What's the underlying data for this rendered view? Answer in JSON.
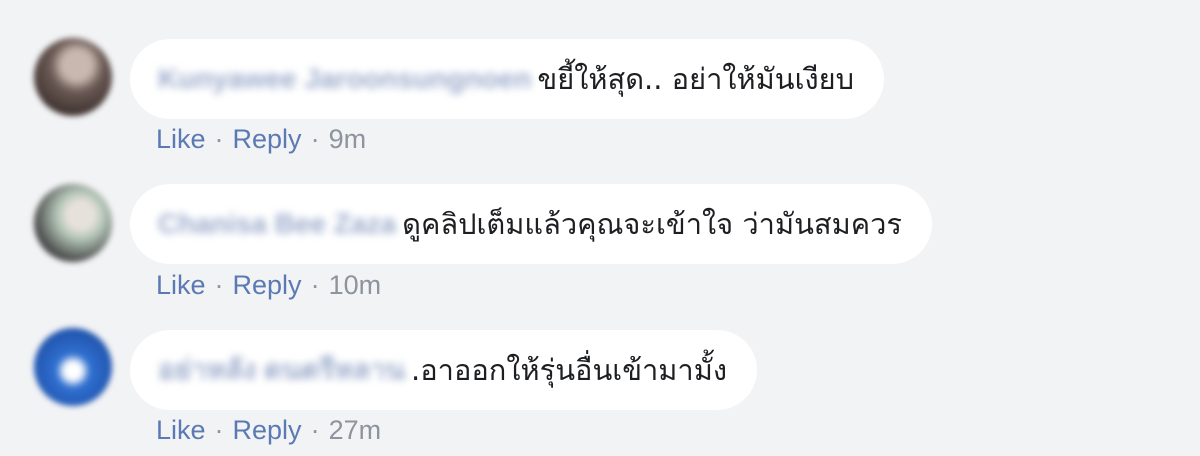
{
  "comments": [
    {
      "author": "Kunyawee Jaroonsungnoen",
      "text": "ขยี้ให้สุด.. อย่าให้มันเงียบ",
      "like_label": "Like",
      "reply_label": "Reply",
      "time": "9m",
      "avatar_colors": [
        "#6b5a55",
        "#c9b8b0"
      ]
    },
    {
      "author": "Chanisa Bee Zaza",
      "text": "ดูคลิปเต็มแล้วคุณจะเข้าใจ ว่ามันสมควร",
      "like_label": "Like",
      "reply_label": "Reply",
      "time": "10m",
      "avatar_colors": [
        "#4a4a4a",
        "#b5c7b9"
      ]
    },
    {
      "author": "อย่าหลัง ดนตรีหลาน",
      "text": ".อาออกให้รุ่นอื่นเข้ามามั้ง",
      "like_label": "Like",
      "reply_label": "Reply",
      "time": "27m",
      "avatar_colors": [
        "#2f6fd0",
        "#ffffff"
      ]
    }
  ],
  "separator": "·"
}
